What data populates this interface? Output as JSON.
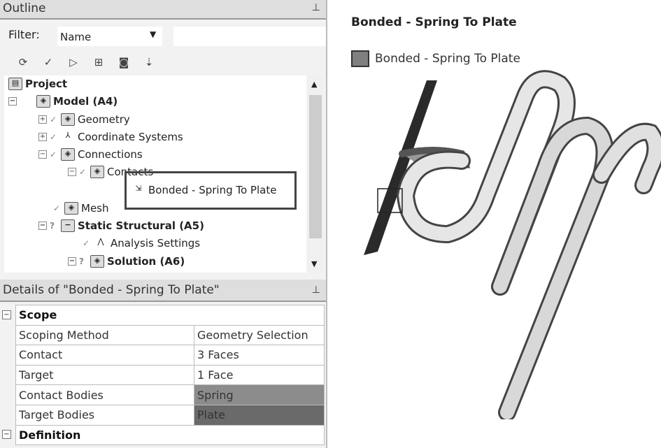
{
  "outline": {
    "title": "Outline",
    "filter_label": "Filter:",
    "filter_value": "Name",
    "toolbar": [
      "refresh-icon",
      "check-icon",
      "connect-icon",
      "expand-icon",
      "suppress-icon",
      "sort-az-icon"
    ],
    "tree": [
      {
        "label": "Project",
        "bold": true
      },
      {
        "label": "Model (A4)",
        "bold": true
      },
      {
        "label": "Geometry"
      },
      {
        "label": "Coordinate Systems"
      },
      {
        "label": "Connections"
      },
      {
        "label": "Contacts"
      },
      {
        "label": "Bonded - Spring To Plate",
        "selected": true
      },
      {
        "label": "Mesh"
      },
      {
        "label": "Static Structural (A5)",
        "bold": true
      },
      {
        "label": "Analysis Settings"
      },
      {
        "label": "Solution (A6)",
        "bold": true
      }
    ]
  },
  "details": {
    "title": "Details of \"Bonded - Spring To Plate\"",
    "groups": [
      {
        "label": "Scope",
        "rows": [
          {
            "name": "Scoping Method",
            "value": "Geometry Selection"
          },
          {
            "name": "Contact",
            "value": "3 Faces"
          },
          {
            "name": "Target",
            "value": "1 Face"
          },
          {
            "name": "Contact Bodies",
            "value": "Spring",
            "color": "#8c8c8c"
          },
          {
            "name": "Target Bodies",
            "value": "Plate",
            "color": "#6a6a6a"
          }
        ]
      },
      {
        "label": "Definition"
      }
    ]
  },
  "graphics": {
    "title": "Bonded - Spring To Plate",
    "legend": "Bonded - Spring To Plate",
    "legend_color": "#808080"
  }
}
